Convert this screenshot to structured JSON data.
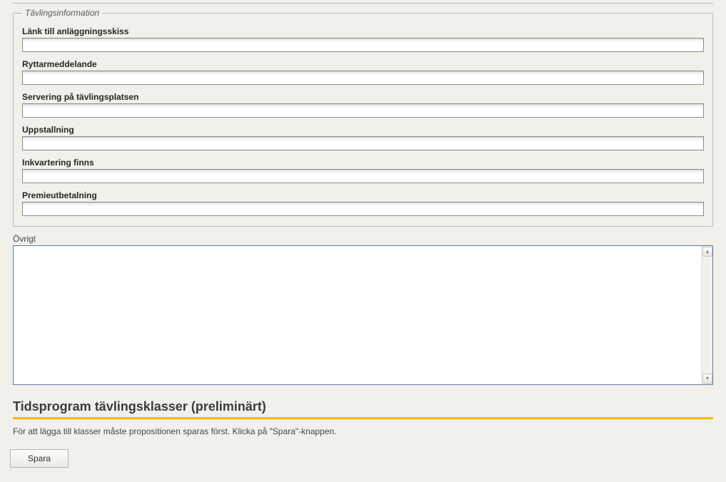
{
  "fieldset": {
    "legend": "Tävlingsinformation",
    "fields": {
      "link": {
        "label": "Länk till anläggningsskiss",
        "value": ""
      },
      "rider_msg": {
        "label": "Ryttarmeddelande",
        "value": ""
      },
      "catering": {
        "label": "Servering på tävlingsplatsen",
        "value": ""
      },
      "stabling": {
        "label": "Uppstallning",
        "value": ""
      },
      "lodging": {
        "label": "Inkvartering finns",
        "value": ""
      },
      "payout": {
        "label": "Premieutbetalning",
        "value": ""
      }
    }
  },
  "other": {
    "label": "Övrigt",
    "value": ""
  },
  "schedule": {
    "heading": "Tidsprogram tävlingsklasser (preliminärt)",
    "note": "För att lägga till klasser måste propositionen sparas först. Klicka på \"Spara\"-knappen."
  },
  "buttons": {
    "save": "Spara"
  },
  "glyphs": {
    "arrow_up": "▴",
    "arrow_down": "▾"
  }
}
